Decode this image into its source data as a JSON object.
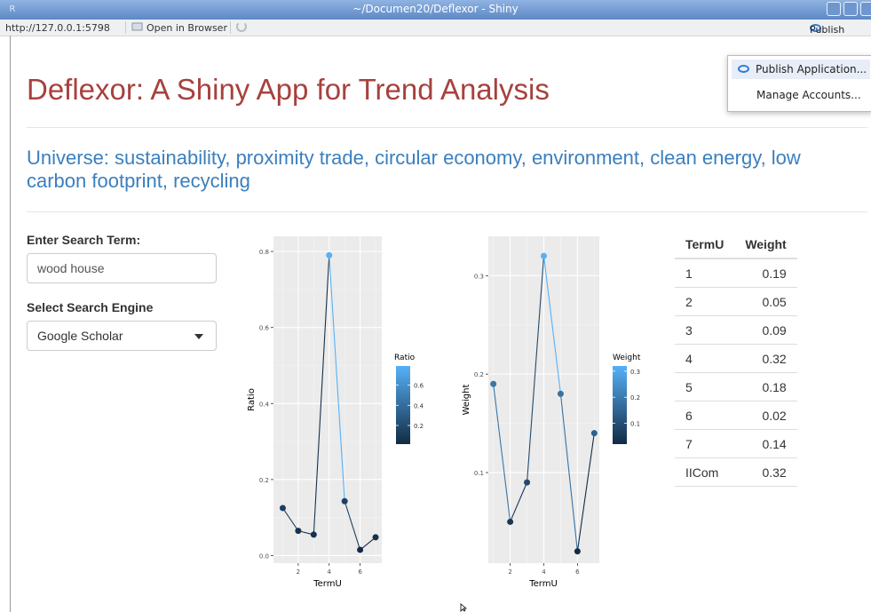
{
  "window": {
    "title": "~/Documen20/Deflexor - Shiny",
    "app_icon": "R"
  },
  "toolbar": {
    "url": "http://127.0.0.1:5798",
    "open_browser": "Open in Browser",
    "publish": "Publish"
  },
  "publish_menu": {
    "items": [
      "Publish Application...",
      "Manage Accounts..."
    ]
  },
  "app": {
    "title": "Deflexor: A Shiny App for Trend Analysis",
    "universe": "Universe: sustainability, proximity trade, circular economy, environment, clean energy, low carbon footprint, recycling",
    "search_label": "Enter Search Term:",
    "search_value": "wood house",
    "engine_label": "Select Search Engine",
    "engine_value": "Google Scholar"
  },
  "chart_data": [
    {
      "type": "line",
      "xlabel": "TermU",
      "ylabel": "Ratio",
      "x": [
        1,
        2,
        3,
        4,
        5,
        6,
        7
      ],
      "y": [
        0.125,
        0.065,
        0.055,
        0.79,
        0.143,
        0.015,
        0.048
      ],
      "xticks": [
        "2",
        "4",
        "6"
      ],
      "yticks": [
        "0.0",
        "0.2",
        "0.4",
        "0.6",
        "0.8"
      ],
      "legend": {
        "title": "Ratio",
        "labels": [
          "0.6",
          "0.4",
          "0.2"
        ]
      }
    },
    {
      "type": "line",
      "xlabel": "TermU",
      "ylabel": "Weight",
      "x": [
        1,
        2,
        3,
        4,
        5,
        6,
        7
      ],
      "y": [
        0.19,
        0.05,
        0.09,
        0.32,
        0.18,
        0.02,
        0.14
      ],
      "xticks": [
        "2",
        "4",
        "6"
      ],
      "yticks": [
        "0.1",
        "0.2",
        "0.3"
      ],
      "legend": {
        "title": "Weight",
        "labels": [
          "0.3",
          "0.2",
          "0.1"
        ]
      }
    }
  ],
  "table": {
    "headers": [
      "TermU",
      "Weight"
    ],
    "rows": [
      [
        "1",
        "0.19"
      ],
      [
        "2",
        "0.05"
      ],
      [
        "3",
        "0.09"
      ],
      [
        "4",
        "0.32"
      ],
      [
        "5",
        "0.18"
      ],
      [
        "6",
        "0.02"
      ],
      [
        "7",
        "0.14"
      ],
      [
        "IICom",
        "0.32"
      ]
    ]
  }
}
